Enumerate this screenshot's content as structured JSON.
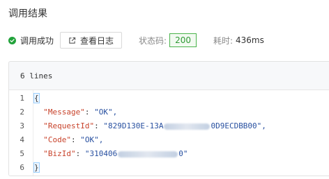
{
  "page_title": "调用结果",
  "toolbar": {
    "status_text": "调用成功",
    "log_button_label": "查看日志",
    "status_code_label": "状态码:",
    "status_code_value": "200",
    "time_label": "耗时:",
    "time_value": "436ms"
  },
  "response": {
    "line_count_label": "6 lines",
    "line_numbers": [
      "1",
      "2",
      "3",
      "4",
      "5",
      "6"
    ],
    "open_brace": "{",
    "close_brace": "}",
    "fields": [
      {
        "key": "\"Message\"",
        "value": "\"OK\","
      },
      {
        "key": "\"RequestId\"",
        "value_start": "\"829D130E-13A",
        "value_end": "0D9ECDBB00\","
      },
      {
        "key": "\"Code\"",
        "value": "\"OK\","
      },
      {
        "key": "\"BizId\"",
        "value_start": "\"310406",
        "value_end": "0\""
      }
    ]
  },
  "colors": {
    "success": "#22a33b",
    "json_key": "#c8432b",
    "json_string": "#2850a0"
  },
  "icons": {
    "status": "check-circle-icon",
    "log": "external-link-icon"
  }
}
